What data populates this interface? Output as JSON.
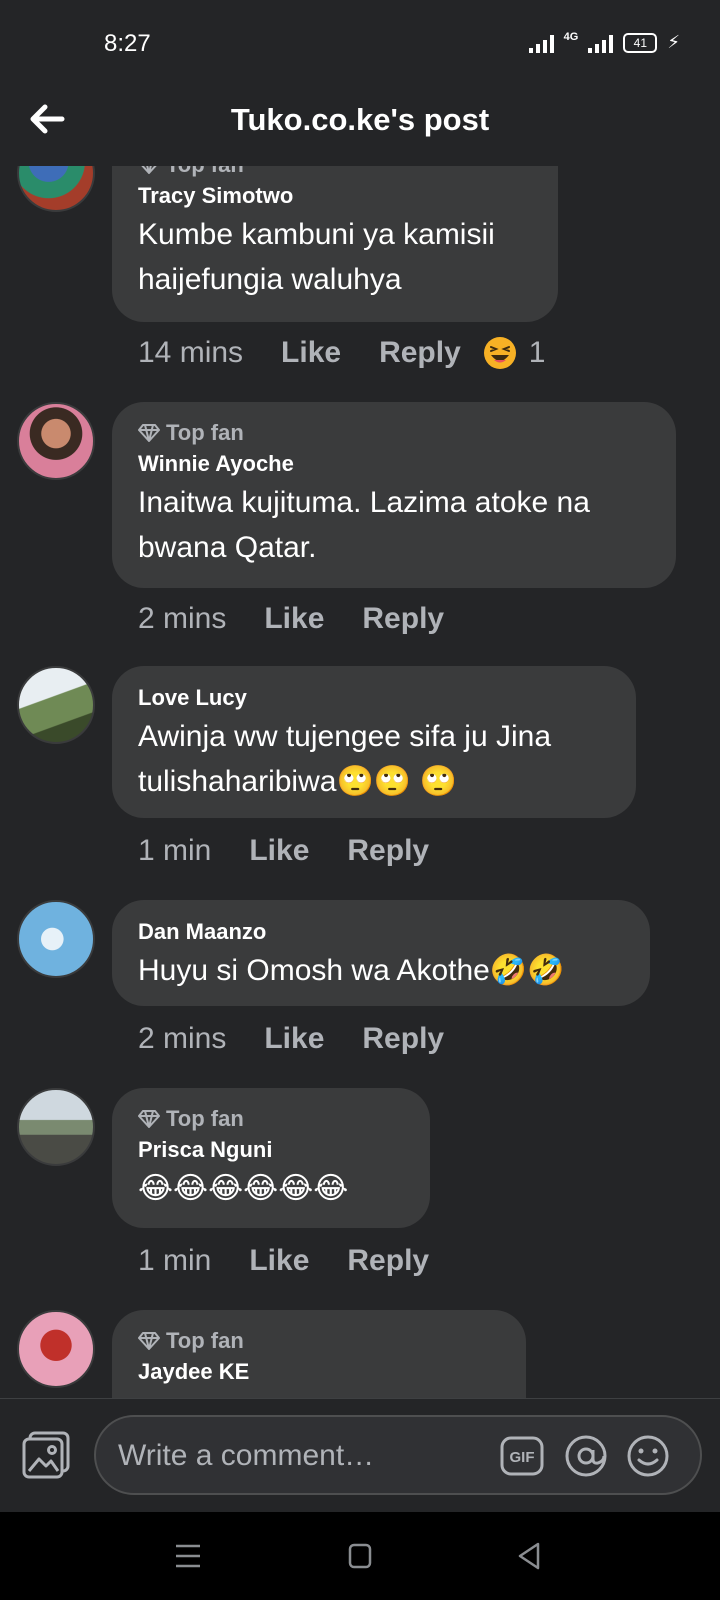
{
  "status": {
    "time": "8:27",
    "network": "4G",
    "battery": "41"
  },
  "header": {
    "title": "Tuko.co.ke's post"
  },
  "comments": [
    {
      "top_fan": "Top fan",
      "author": "Tracy Simotwo",
      "text": "Kumbe kambuni ya kamisii\nhaijefungia waluhya",
      "time": "14 mins",
      "like": "Like",
      "reply": "Reply",
      "reaction_count": "1"
    },
    {
      "top_fan": "Top fan",
      "author": "Winnie Ayoche",
      "text": "Inaitwa kujituma. Lazima atoke na\nbwana Qatar.",
      "time": "2 mins",
      "like": "Like",
      "reply": "Reply"
    },
    {
      "author": "Love Lucy",
      "text": "Awinja ww tujengee sifa ju Jina\ntulishaharibiwa🙄🙄 🙄",
      "time": "1 min",
      "like": "Like",
      "reply": "Reply"
    },
    {
      "author": "Dan Maanzo",
      "text": "Huyu si Omosh wa Akothe🤣🤣",
      "time": "2 mins",
      "like": "Like",
      "reply": "Reply"
    },
    {
      "top_fan": "Top fan",
      "author": "Prisca Nguni",
      "text": "😂😂😂😂😂😂",
      "time": "1 min",
      "like": "Like",
      "reply": "Reply"
    },
    {
      "top_fan": "Top fan",
      "author": "Jaydee KE"
    }
  ],
  "composer": {
    "placeholder": "Write a comment…",
    "gif_label": "GIF"
  },
  "colors": {
    "background": "#242527",
    "bubble": "#3a3b3c",
    "secondary_text": "#b0b3b8"
  }
}
